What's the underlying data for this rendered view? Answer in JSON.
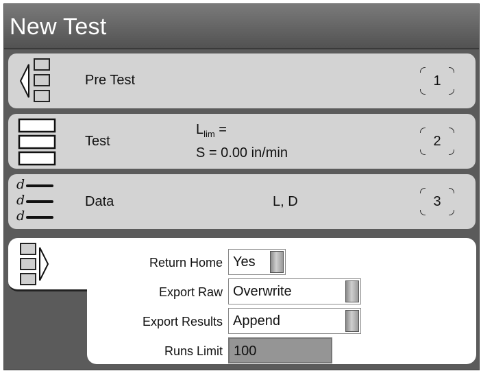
{
  "window": {
    "title": "New Test"
  },
  "steps": [
    {
      "label": "Pre Test",
      "number": "1",
      "icon": "pretest-icon"
    },
    {
      "label": "Test",
      "number": "2",
      "icon": "test-icon",
      "param1_main": "L",
      "param1_sub": "lim",
      "param1_suffix": " =",
      "param2": "S = 0.00 in/min"
    },
    {
      "label": "Data",
      "number": "3",
      "icon": "data-icon",
      "info": "L, D",
      "glyph": "d"
    }
  ],
  "post_test": {
    "icon": "posttest-icon",
    "fields": [
      {
        "label": "Return Home",
        "value": "Yes"
      },
      {
        "label": "Export Raw",
        "value": "Overwrite"
      },
      {
        "label": "Export Results",
        "value": "Append"
      },
      {
        "label": "Runs Limit",
        "value": "100"
      }
    ]
  }
}
